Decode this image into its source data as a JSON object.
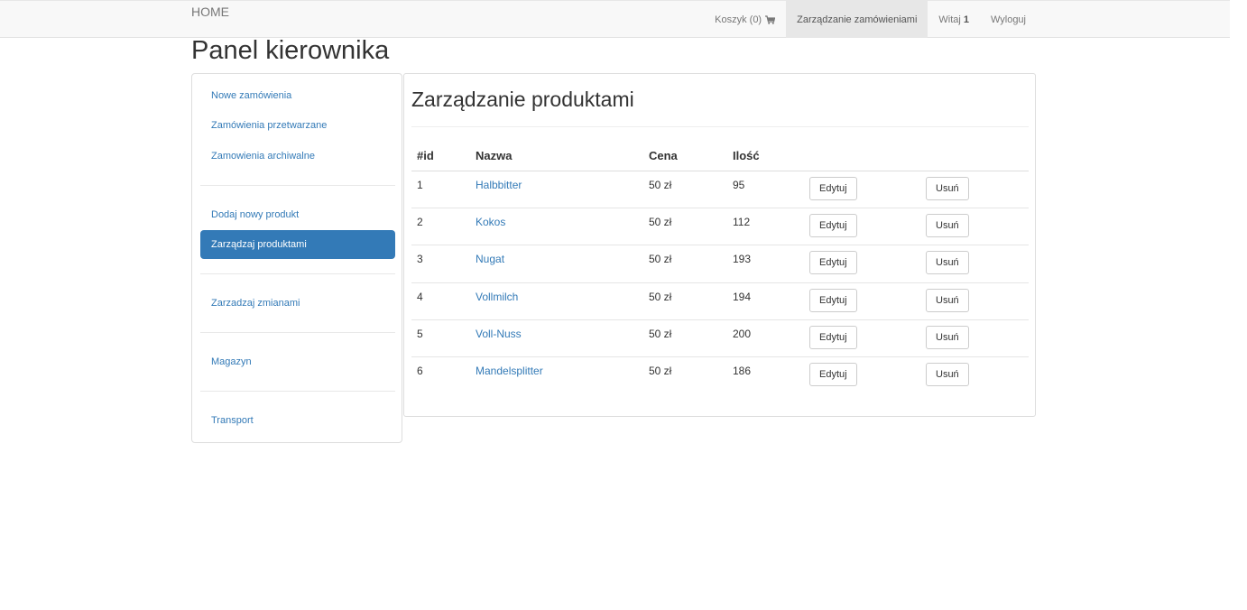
{
  "navbar": {
    "brand": "HOME",
    "cart_label": "Koszyk (0)",
    "orders_label": "Zarządzanie zamówieniami",
    "greeting_label": "Witaj",
    "greeting_user": "1",
    "logout_label": "Wyloguj"
  },
  "page": {
    "title": "Panel kierownika"
  },
  "sidebar": {
    "items": [
      {
        "label": "Nowe zamówienia"
      },
      {
        "label": "Zamówienia przetwarzane"
      },
      {
        "label": "Zamowienia archiwalne"
      },
      {
        "label": "Dodaj nowy produkt"
      },
      {
        "label": "Zarządzaj produktami"
      },
      {
        "label": "Zarzadzaj zmianami"
      },
      {
        "label": "Magazyn"
      },
      {
        "label": "Transport"
      }
    ]
  },
  "main": {
    "title": "Zarządzanie produktami",
    "columns": [
      "#id",
      "Nazwa",
      "Cena",
      "Ilość"
    ],
    "edit_label": "Edytuj",
    "delete_label": "Usuń",
    "rows": [
      {
        "id": "1",
        "name": "Halbbitter",
        "price": "50 zł",
        "qty": "95"
      },
      {
        "id": "2",
        "name": "Kokos",
        "price": "50 zł",
        "qty": "112"
      },
      {
        "id": "3",
        "name": "Nugat",
        "price": "50 zł",
        "qty": "193"
      },
      {
        "id": "4",
        "name": "Vollmilch",
        "price": "50 zł",
        "qty": "194"
      },
      {
        "id": "5",
        "name": "Voll-Nuss",
        "price": "50 zł",
        "qty": "200"
      },
      {
        "id": "6",
        "name": "Mandelsplitter",
        "price": "50 zł",
        "qty": "186"
      }
    ]
  },
  "colors": {
    "accent": "#337ab7",
    "navbar_bg": "#f8f8f8",
    "nav_active_bg": "#e7e7e7"
  }
}
